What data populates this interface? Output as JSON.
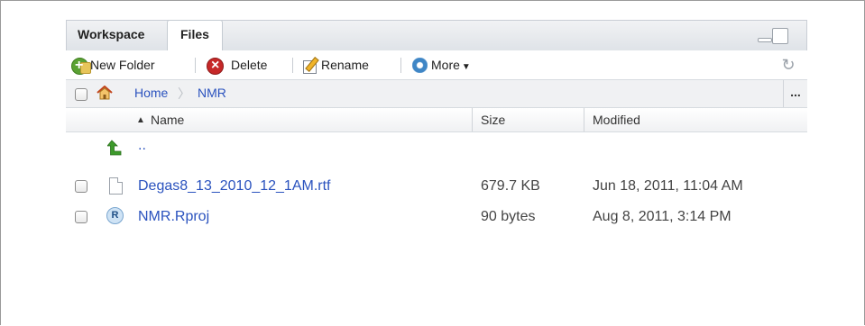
{
  "tabs": {
    "workspace": "Workspace",
    "files": "Files"
  },
  "toolbar": {
    "new_folder": "New Folder",
    "delete": "Delete",
    "rename": "Rename",
    "more": "More"
  },
  "breadcrumb": {
    "home": "Home",
    "current": "NMR",
    "overflow": "..."
  },
  "columns": {
    "name": "Name",
    "size": "Size",
    "modified": "Modified"
  },
  "sort_indicator": "▲",
  "parent_link": "..",
  "files": [
    {
      "name": "Degas8_13_2010_12_1AM.rtf",
      "size": "679.7 KB",
      "modified": "Jun 18, 2011, 11:04 AM",
      "icon": "document-icon"
    },
    {
      "name": "NMR.Rproj",
      "size": "90 bytes",
      "modified": "Aug 8, 2011, 3:14 PM",
      "icon": "rproj-icon"
    }
  ],
  "colors": {
    "link": "#2a52be",
    "accent_green": "#5aa133",
    "delete_red": "#c62828"
  }
}
